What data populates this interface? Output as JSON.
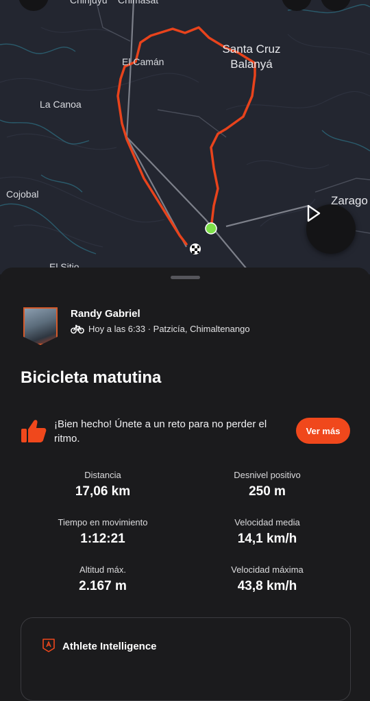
{
  "map": {
    "places": {
      "chinjuyu": "Chinjuyú",
      "chimasat": "Chimasat",
      "el_caman": "El Camán",
      "santa_cruz_line1": "Santa Cruz",
      "santa_cruz_line2": "Balanyá",
      "la_canoa": "La Canoa",
      "cojobal": "Cojobal",
      "zaragoza": "Zarago",
      "el_sitio": "El Sitio"
    },
    "route_color": "#e8431c",
    "start_color": "#7ee04a"
  },
  "activity": {
    "athlete_name": "Randy Gabriel",
    "meta": "Hoy a las 6:33 · Patzicía, Chimaltenango",
    "title": "Bicicleta matutina"
  },
  "promo": {
    "text": "¡Bien hecho! Únete a un reto para no perder el ritmo.",
    "button": "Ver más"
  },
  "stats": [
    {
      "label": "Distancia",
      "value": "17,06 km"
    },
    {
      "label": "Desnivel positivo",
      "value": "250 m"
    },
    {
      "label": "Tiempo en movimiento",
      "value": "1:12:21"
    },
    {
      "label": "Velocidad media",
      "value": "14,1 km/h"
    },
    {
      "label": "Altitud máx.",
      "value": "2.167 m"
    },
    {
      "label": "Velocidad máxima",
      "value": "43,8 km/h"
    }
  ],
  "athlete_intelligence": {
    "title": "Athlete Intelligence"
  },
  "colors": {
    "accent": "#f0481c",
    "background": "#1b1b1d"
  }
}
